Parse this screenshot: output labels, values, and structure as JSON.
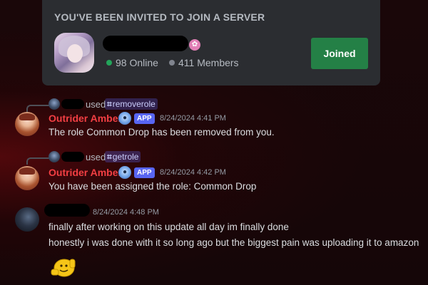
{
  "invite": {
    "header": "YOU'VE BEEN INVITED TO JOIN A SERVER",
    "online_count": "98 Online",
    "members_count": "411 Members",
    "joined_label": "Joined"
  },
  "messages": [
    {
      "reply": {
        "used": "used",
        "command": "removerole"
      },
      "author": "Outrider Amber",
      "tag": "APP",
      "timestamp": "8/24/2024 4:41 PM",
      "lines": [
        "The role Common Drop has been removed from you."
      ]
    },
    {
      "reply": {
        "used": "used",
        "command": "getrole"
      },
      "author": "Outrider Amber",
      "tag": "APP",
      "timestamp": "8/24/2024 4:42 PM",
      "lines": [
        "You have been assigned the role: Common Drop"
      ]
    },
    {
      "timestamp": "8/24/2024 4:48 PM",
      "lines": [
        "finally after working on this update all day im finally done",
        "honestly i was done with it so long ago but the biggest pain was uploading it to amazon"
      ]
    }
  ],
  "colors": {
    "accent_green": "#248046",
    "bot_name": "#f23f43",
    "app_tag": "#5865f2",
    "online_dot": "#23a55a"
  },
  "icons": {
    "partner_badge": "partner-flower-icon",
    "slash_command": "slash-command-icon",
    "bot_emoji": "robot-emoji-icon",
    "sticker": "thumbs-up-emoji-sticker"
  }
}
